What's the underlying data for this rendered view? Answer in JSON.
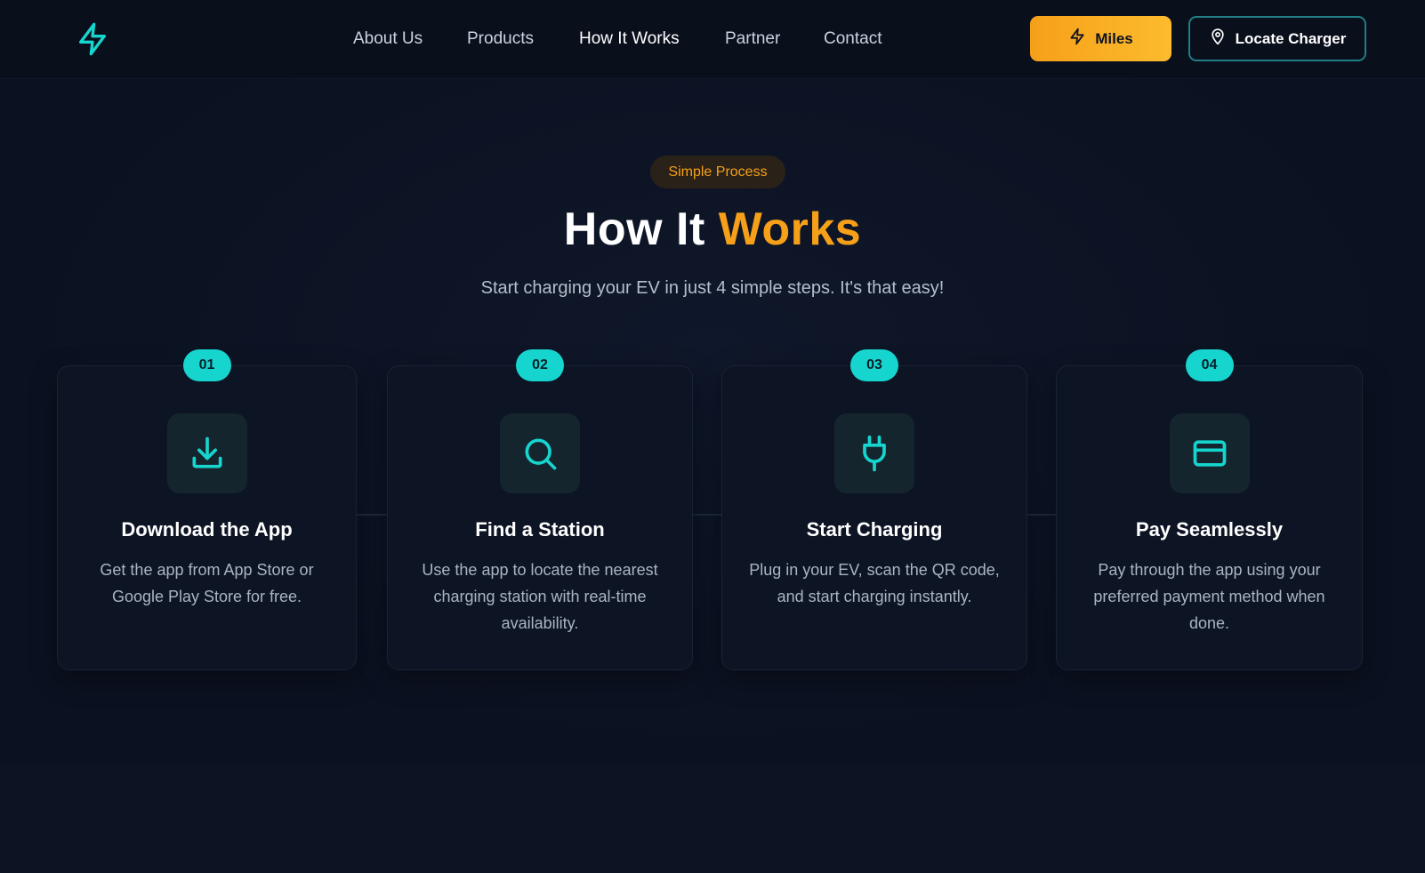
{
  "nav": {
    "links": [
      "About Us",
      "Products",
      "How It Works",
      "Partner",
      "Contact"
    ],
    "miles_label": "Miles",
    "locate_label": "Locate Charger"
  },
  "section": {
    "badge": "Simple Process",
    "title_main": "How It ",
    "title_accent": "Works",
    "subtitle": "Start charging your EV in just 4 simple steps. It's that easy!"
  },
  "steps": [
    {
      "number": "01",
      "title": "Download the App",
      "desc": "Get the app from App Store or Google Play Store for free.",
      "icon": "download-icon"
    },
    {
      "number": "02",
      "title": "Find a Station",
      "desc": "Use the app to locate the nearest charging station with real-time availability.",
      "icon": "search-icon"
    },
    {
      "number": "03",
      "title": "Start Charging",
      "desc": "Plug in your EV, scan the QR code, and start charging instantly.",
      "icon": "plug-icon"
    },
    {
      "number": "04",
      "title": "Pay Seamlessly",
      "desc": "Pay through the app using your preferred payment method when done.",
      "icon": "credit-card-icon"
    }
  ],
  "colors": {
    "accent_orange": "#f6a019",
    "accent_teal": "#16d5cf",
    "background": "#0b1120"
  }
}
